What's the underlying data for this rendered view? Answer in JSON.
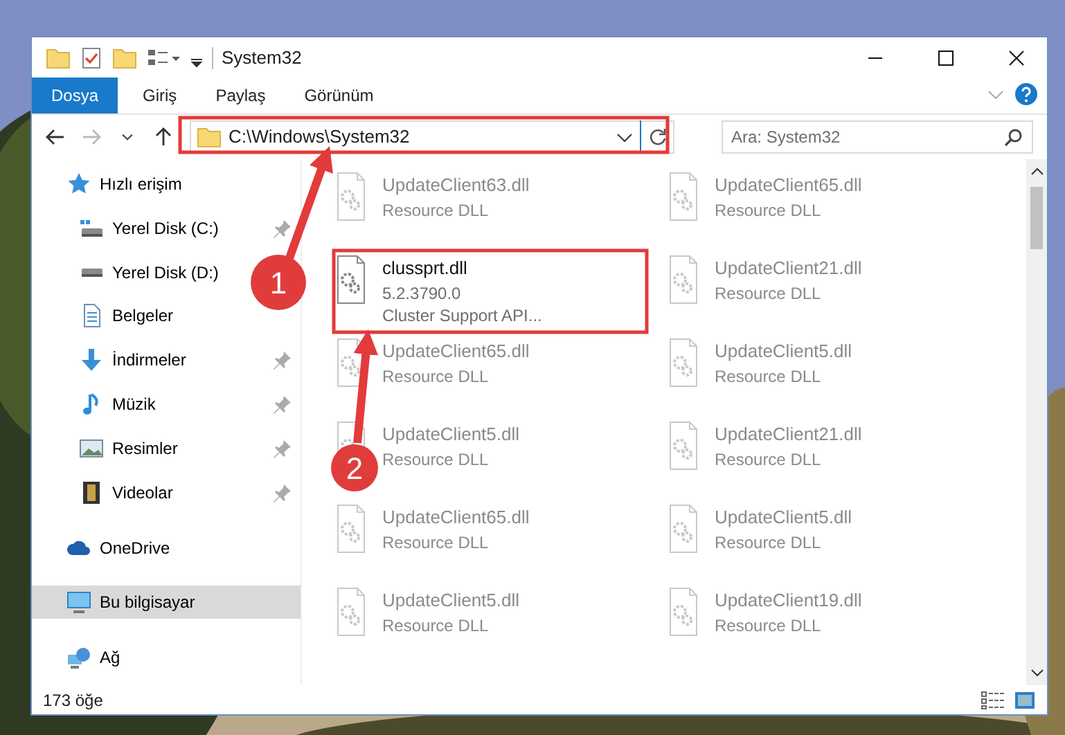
{
  "window": {
    "title": "System32"
  },
  "ribbon": {
    "tabs": [
      {
        "label": "Dosya",
        "selected": true
      },
      {
        "label": "Giriş",
        "selected": false
      },
      {
        "label": "Paylaş",
        "selected": false
      },
      {
        "label": "Görünüm",
        "selected": false
      }
    ]
  },
  "address_bar": {
    "path": "C:\\Windows\\System32"
  },
  "search": {
    "placeholder": "Ara: System32"
  },
  "nav_pane": {
    "items": [
      {
        "label": "Hızlı erişim",
        "kind": "quick",
        "selected": false,
        "children": [
          {
            "label": "Yerel Disk (C:)",
            "kind": "system-drive",
            "pinned": true,
            "selected": false
          },
          {
            "label": "Yerel Disk (D:)",
            "kind": "drive",
            "pinned": false,
            "selected": false
          },
          {
            "label": "Belgeler",
            "kind": "documents",
            "pinned": false,
            "selected": false
          },
          {
            "label": "İndirmeler",
            "kind": "downloads",
            "pinned": true,
            "selected": false
          },
          {
            "label": "Müzik",
            "kind": "music",
            "pinned": true,
            "selected": false
          },
          {
            "label": "Resimler",
            "kind": "pictures",
            "pinned": true,
            "selected": false
          },
          {
            "label": "Videolar",
            "kind": "videos",
            "pinned": true,
            "selected": false
          }
        ]
      },
      {
        "label": "OneDrive",
        "kind": "cloud",
        "selected": false
      },
      {
        "label": "Bu bilgisayar",
        "kind": "computer",
        "selected": true
      },
      {
        "label": "Ağ",
        "kind": "network",
        "selected": false
      }
    ]
  },
  "files": [
    {
      "name": "UpdateClient63.dll",
      "details": [
        "Resource DLL"
      ],
      "faded": true
    },
    {
      "name": "UpdateClient65.dll",
      "details": [
        "Resource DLL"
      ],
      "faded": true
    },
    {
      "name": "clussprt.dll",
      "details": [
        "5.2.3790.0",
        "Cluster Support API..."
      ],
      "faded": false
    },
    {
      "name": "UpdateClient21.dll",
      "details": [
        "Resource DLL"
      ],
      "faded": true
    },
    {
      "name": "UpdateClient65.dll",
      "details": [
        "Resource DLL"
      ],
      "faded": true
    },
    {
      "name": "UpdateClient5.dll",
      "details": [
        "Resource DLL"
      ],
      "faded": true
    },
    {
      "name": "UpdateClient5.dll",
      "details": [
        "Resource DLL"
      ],
      "faded": true
    },
    {
      "name": "UpdateClient21.dll",
      "details": [
        "Resource DLL"
      ],
      "faded": true
    },
    {
      "name": "UpdateClient65.dll",
      "details": [
        "Resource DLL"
      ],
      "faded": true
    },
    {
      "name": "UpdateClient5.dll",
      "details": [
        "Resource DLL"
      ],
      "faded": true
    },
    {
      "name": "UpdateClient5.dll",
      "details": [
        "Resource DLL"
      ],
      "faded": true
    },
    {
      "name": "UpdateClient19.dll",
      "details": [
        "Resource DLL"
      ],
      "faded": true
    }
  ],
  "status_bar": {
    "item_count": "173 öğe"
  },
  "annotations": [
    {
      "label": "1"
    },
    {
      "label": "2"
    }
  ]
}
